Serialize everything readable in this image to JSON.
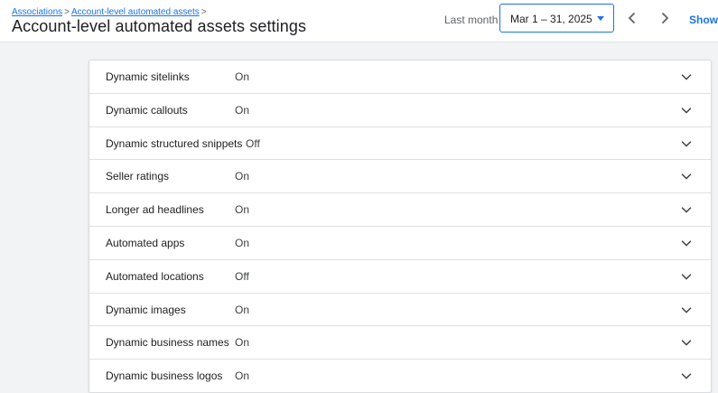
{
  "breadcrumb": {
    "items": [
      "Associations",
      "Account-level automated assets"
    ],
    "separator": ">"
  },
  "page_title": "Account-level automated assets settings",
  "date_range": {
    "label": "Last month",
    "value": "Mar 1 – 31, 2025"
  },
  "show_link": "Show l",
  "settings": [
    {
      "name": "Dynamic sitelinks",
      "status": "On"
    },
    {
      "name": "Dynamic callouts",
      "status": "On"
    },
    {
      "name": "Dynamic structured snippets",
      "status": "Off"
    },
    {
      "name": "Seller ratings",
      "status": "On"
    },
    {
      "name": "Longer ad headlines",
      "status": "On"
    },
    {
      "name": "Automated apps",
      "status": "On"
    },
    {
      "name": "Automated locations",
      "status": "Off"
    },
    {
      "name": "Dynamic images",
      "status": "On"
    },
    {
      "name": "Dynamic business names",
      "status": "On"
    },
    {
      "name": "Dynamic business logos",
      "status": "On"
    }
  ],
  "icons": {
    "prev": "chevron-left-icon",
    "next": "chevron-right-icon",
    "expand": "chevron-down-icon",
    "dropdown": "caret-down-icon"
  },
  "colors": {
    "accent": "#1a73e8",
    "background": "#f1f3f4"
  }
}
